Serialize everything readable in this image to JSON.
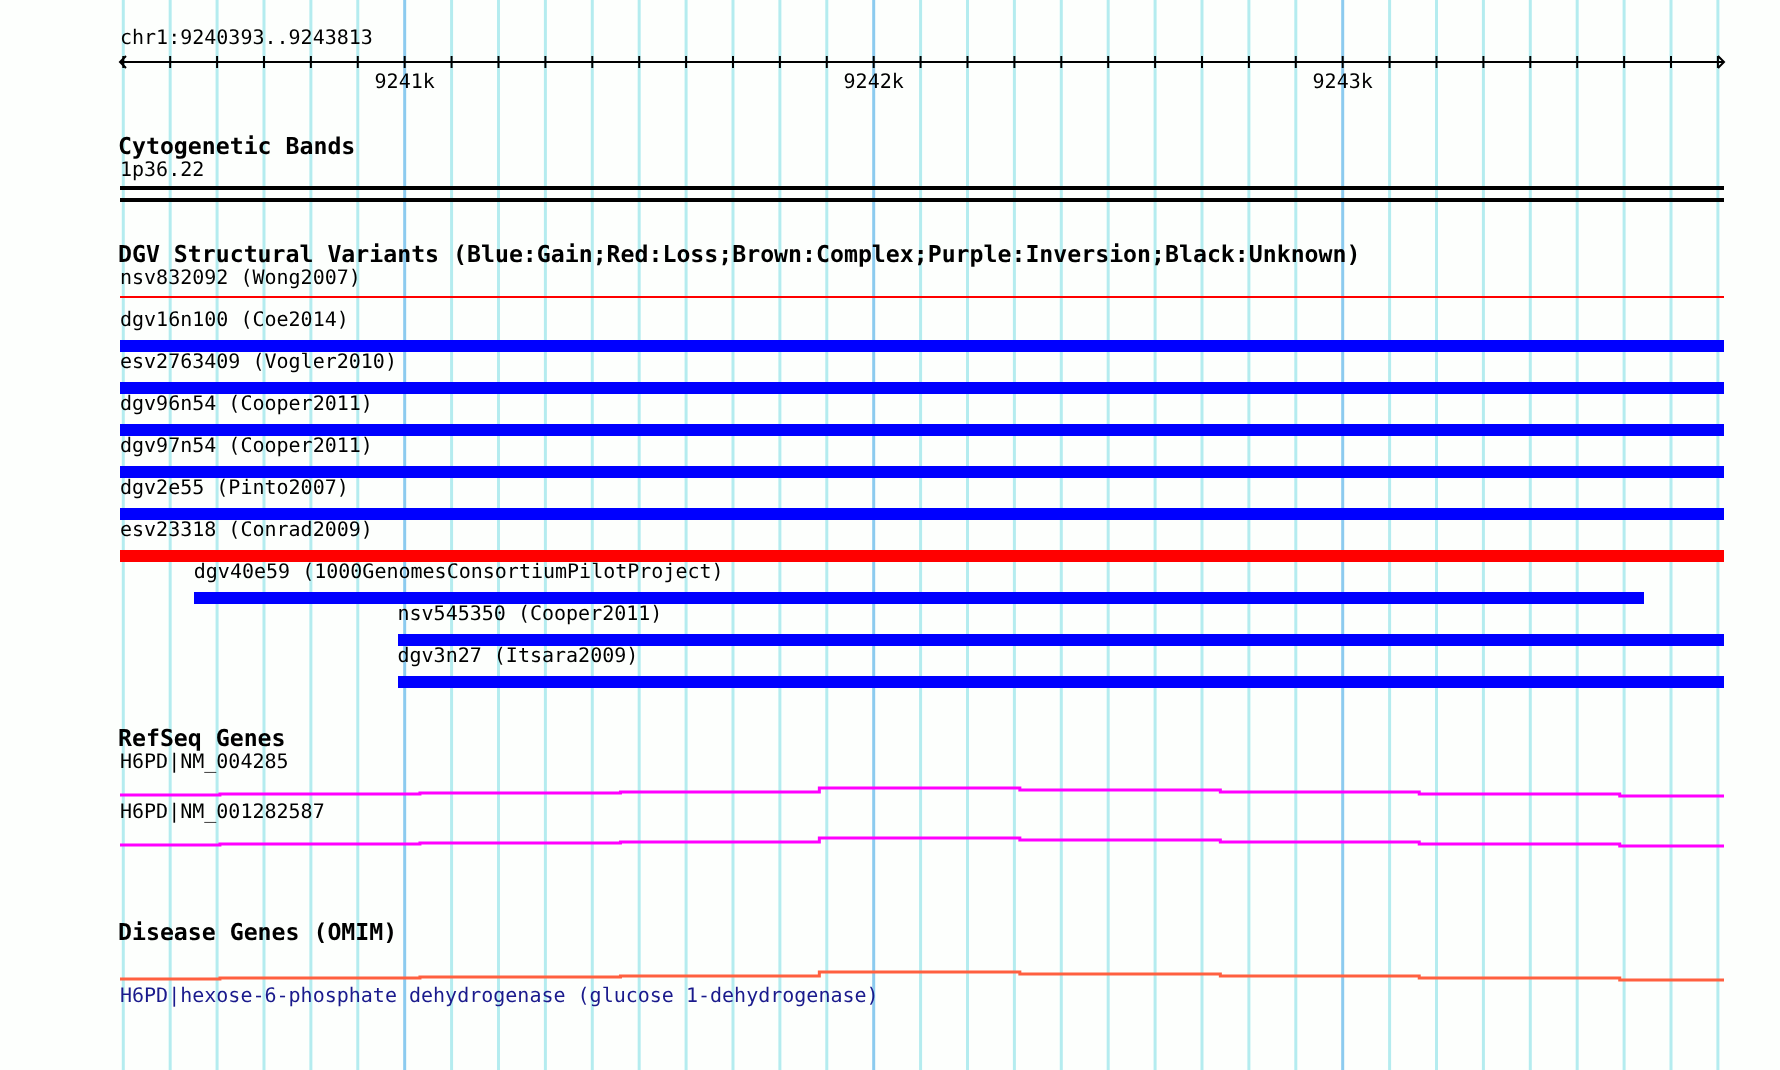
{
  "ruler": {
    "region": "chr1:9240393..9243813",
    "tick_labels": [
      "9241k",
      "9242k",
      "9243k"
    ]
  },
  "tracks": [
    {
      "kind": "cytoband",
      "title": "Cytogenetic Bands",
      "features": [
        {
          "label": "1p36.22"
        }
      ]
    },
    {
      "kind": "variants",
      "title": "DGV Structural Variants (Blue:Gain;Red:Loss;Brown:Complex;Purple:Inversion;Black:Unknown)",
      "features": [
        {
          "label": "nsv832092 (Wong2007)",
          "color": "#ff0000",
          "kind": "thin"
        },
        {
          "label": "dgv16n100 (Coe2014)",
          "color": "#0000ff",
          "kind": "bar"
        },
        {
          "label": "esv2763409 (Vogler2010)",
          "color": "#0000ff",
          "kind": "bar"
        },
        {
          "label": "dgv96n54 (Cooper2011)",
          "color": "#0000ff",
          "kind": "bar"
        },
        {
          "label": "dgv97n54 (Cooper2011)",
          "color": "#0000ff",
          "kind": "bar"
        },
        {
          "label": "dgv2e55 (Pinto2007)",
          "color": "#0000ff",
          "kind": "bar"
        },
        {
          "label": "esv23318 (Conrad2009)",
          "color": "#ff0000",
          "kind": "bar"
        },
        {
          "label": "dgv40e59 (1000GenomesConsortiumPilotProject)",
          "color": "#0000ff",
          "kind": "bar"
        },
        {
          "label": "nsv545350 (Cooper2011)",
          "color": "#0000ff",
          "kind": "bar"
        },
        {
          "label": "dgv3n27 (Itsara2009)",
          "color": "#0000ff",
          "kind": "bar"
        }
      ]
    },
    {
      "kind": "genes",
      "title": "RefSeq Genes",
      "features": [
        {
          "label": "H6PD|NM_004285"
        },
        {
          "label": "H6PD|NM_001282587"
        }
      ]
    },
    {
      "kind": "disease",
      "title": "Disease Genes (OMIM)",
      "features": [
        {
          "label": "H6PD|hexose-6-phosphate dehydrogenase (glucose 1-dehydrogenase)"
        }
      ]
    }
  ]
}
